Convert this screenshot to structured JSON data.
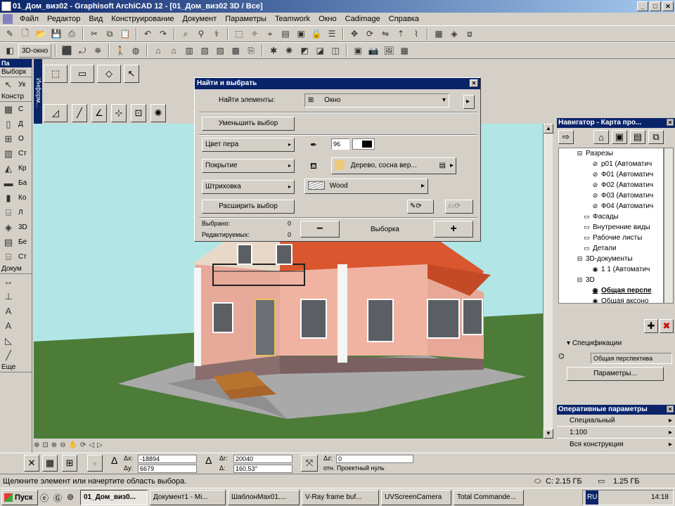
{
  "window": {
    "title": "01_Дом_виз02 - Graphisoft ArchiCAD 12 - [01_Дом_виз02 3D / Все]"
  },
  "menu": [
    "Файл",
    "Редактор",
    "Вид",
    "Конструирование",
    "Документ",
    "Параметры",
    "Teamwork",
    "Окно",
    "Cadimage",
    "Справка"
  ],
  "toolbar2": {
    "view3d": "3D-окно"
  },
  "leftpanel": {
    "header": "Па",
    "selection": "Выборк",
    "select_item": "Ук",
    "construct": "Констр",
    "document": "Докум",
    "more": "Еще",
    "items": [
      "С",
      "Д",
      "О",
      "Ст",
      "Кр",
      "Ба",
      "Ко",
      "Л",
      "3D",
      "Бе",
      "Ст"
    ]
  },
  "infobox_label": "Информ...",
  "dialog": {
    "title": "Найти и выбрать",
    "find_label": "Найти элементы:",
    "find_value": "Окно",
    "reduce_btn": "Уменьшить выбор",
    "pen_color_btn": "Цвет пера",
    "pen_value": "96",
    "surface_btn": "Покрытие",
    "surface_value": "Дерево, сосна вер...",
    "hatch_btn": "Штриховка",
    "hatch_value": "Wood",
    "extend_btn": "Расширить выбор",
    "selected_label": "Выбрано:",
    "selected_count": "0",
    "editable_label": "Редактируемых:",
    "editable_count": "0",
    "minus_btn": "−",
    "selection_label": "Выборка",
    "plus_btn": "+"
  },
  "navigator": {
    "title": "Навигатор - Карта про...",
    "items": [
      {
        "label": "Разрезы",
        "indent": 1
      },
      {
        "label": "р01 (Автоматич",
        "indent": 2
      },
      {
        "label": "Ф01 (Автоматич",
        "indent": 2
      },
      {
        "label": "Ф02 (Автоматич",
        "indent": 2
      },
      {
        "label": "Ф03 (Автоматич",
        "indent": 2
      },
      {
        "label": "Ф04 (Автоматич",
        "indent": 2
      },
      {
        "label": "Фасады",
        "indent": 1
      },
      {
        "label": "Внутренние виды",
        "indent": 1
      },
      {
        "label": "Рабочие листы",
        "indent": 1
      },
      {
        "label": "Детали",
        "indent": 1
      },
      {
        "label": "3D-документы",
        "indent": 1
      },
      {
        "label": "1 1 (Автоматич",
        "indent": 2
      },
      {
        "label": "3D",
        "indent": 1
      },
      {
        "label": "Общая перспе",
        "indent": 2,
        "selected": true
      },
      {
        "label": "Общая аксоно",
        "indent": 2
      }
    ],
    "specs_label": "Спецификации",
    "specs_value": "Общая перспектива",
    "params_btn": "Параметры..."
  },
  "quickparams": {
    "title": "Оперативные параметры",
    "special": "Специальный",
    "scale": "1:100",
    "construction": "Вся конструкция"
  },
  "coords": {
    "dx_label": "Δx:",
    "dx": "-18894",
    "dy_label": "Δy:",
    "dy": "6679",
    "dr_label": "Δr:",
    "dr": "20040",
    "da_label": "Δ:",
    "da": "160.53°",
    "dz_label": "Δz:",
    "dz": "0",
    "ref_label": "отн. Проектный нуль"
  },
  "status": {
    "message": "Щелкните элемент или начертите область выбора.",
    "disk_c": "C: 2.15 ГБ",
    "disk_other": "1.25 ГБ"
  },
  "taskbar": {
    "start": "Пуск",
    "tasks": [
      "01_Дом_виз0...",
      "Документ1 - Mi...",
      "ШаблонMax01....",
      "V-Ray frame buf...",
      "UVScreenCamera",
      "Total Commande..."
    ],
    "lang": "RU",
    "clock": "14:18"
  },
  "colors": {
    "titlebar": "#0a246a",
    "wall": "#e6a99a",
    "roof": "#d9562e",
    "sky": "#b2e6e6",
    "grass": "#4c7c38"
  }
}
